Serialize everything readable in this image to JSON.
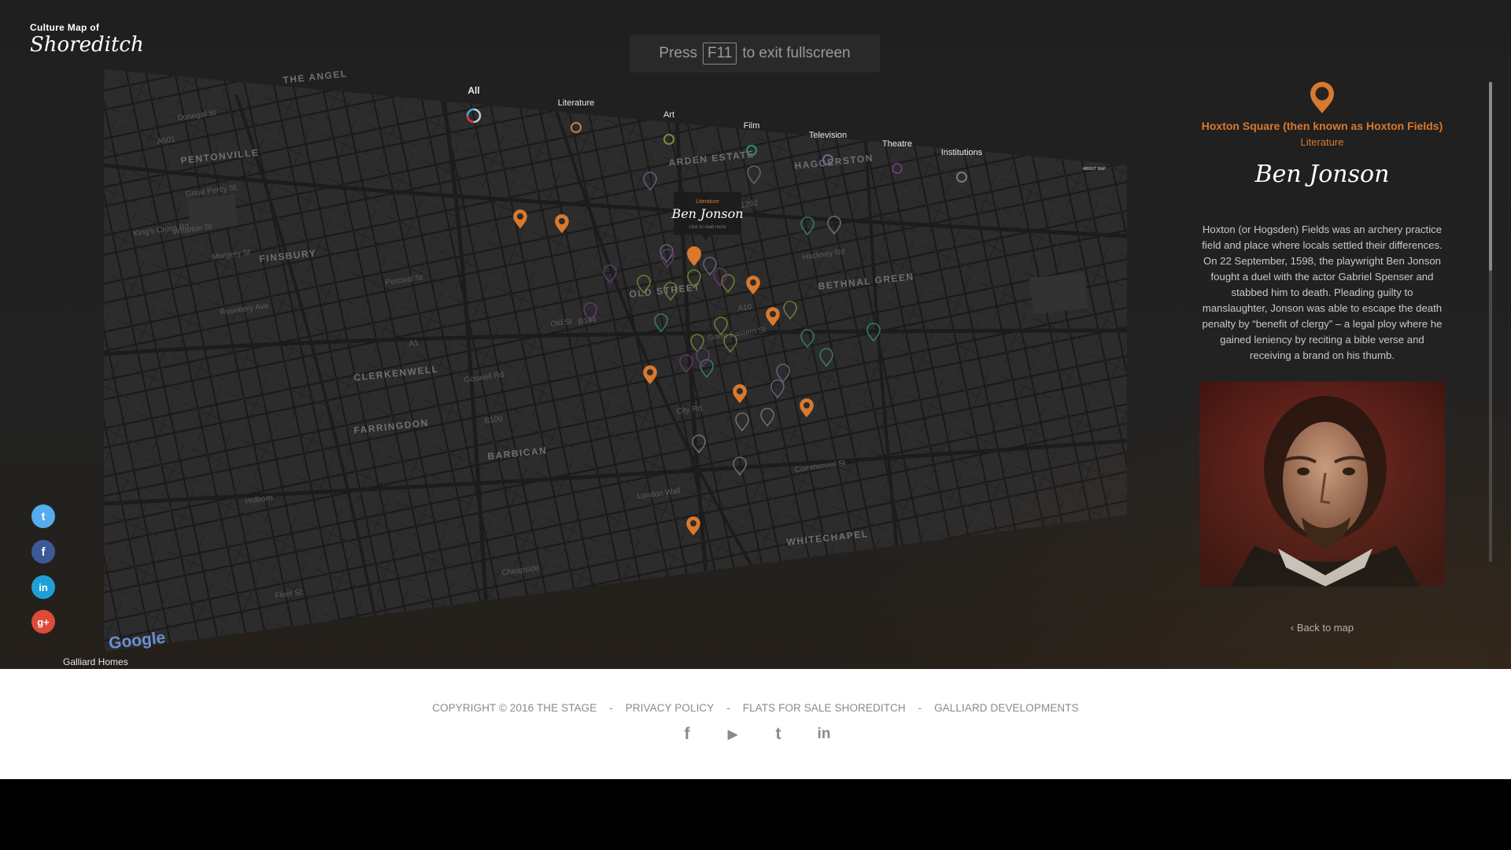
{
  "logo": {
    "line1": "Culture Map of",
    "line2": "Shoreditch"
  },
  "fullscreen_notice": {
    "prefix": "Press",
    "key": "F11",
    "suffix": "to exit fullscreen"
  },
  "map": {
    "categories": [
      {
        "label": "All"
      },
      {
        "label": "Literature"
      },
      {
        "label": "Art"
      },
      {
        "label": "Film"
      },
      {
        "label": "Television"
      },
      {
        "label": "Theatre"
      },
      {
        "label": "Institutions"
      }
    ],
    "areas": [
      "PENTONVILLE",
      "FINSBURY",
      "CLERKENWELL",
      "FARRINGDON",
      "BARBICAN",
      "OLD STREET",
      "HAGGERSTON",
      "ARDEN ESTATE",
      "BETHNAL GREEN",
      "WHITECHAPEL",
      "THE ANGEL"
    ],
    "road_labels": [
      "Donegal St",
      "A501",
      "Great Percy St",
      "King's Cross Rd",
      "Wharton St",
      "Margery St",
      "Rosebery Ave",
      "Percival St",
      "Old St",
      "Goswell Rd",
      "A1",
      "B100",
      "Fleet St",
      "Holborn",
      "Cheapside",
      "London Wall",
      "A10",
      "A1202",
      "B144",
      "City Rd",
      "Hackney Rd",
      "Great Eastern St",
      "Commercial St"
    ],
    "tooltip": {
      "category": "Literature",
      "title": "Ben Jonson",
      "hint": "click to read more"
    },
    "google_logo": "Google",
    "about_label": "ABOUT MAP",
    "colors": {
      "literature": "#d9792e",
      "art": "#7a8a3a",
      "film": "#3a8a6a",
      "television": "#6a6a8a",
      "theatre": "#6a3a7a",
      "institutions": "#7a7a7a"
    }
  },
  "social": [
    {
      "name": "twitter",
      "glyph": "t",
      "color": "#55acee"
    },
    {
      "name": "facebook",
      "glyph": "f",
      "color": "#3b5998"
    },
    {
      "name": "linkedin",
      "glyph": "in",
      "color": "#1e9fd8"
    },
    {
      "name": "google-plus",
      "glyph": "g+",
      "color": "#dd4b39"
    }
  ],
  "galliard_label": "Galliard Homes",
  "detail": {
    "location": "Hoxton Square (then known as Hoxton Fields)",
    "category": "Literature",
    "title": "Ben Jonson",
    "description": "Hoxton (or Hogsden) Fields was an archery practice field and place where locals settled their differences. On 22 September, 1598, the playwright Ben Jonson fought a duel with the actor Gabriel Spenser and stabbed him to death. Pleading guilty to manslaughter, Jonson was able to escape the death penalty by “benefit of clergy” – a legal ploy where he gained leniency by reciting a bible verse and receiving a brand on his thumb.",
    "back_label": "Back to map",
    "accent": "#d9792e"
  },
  "footer": {
    "links": [
      "COPYRIGHT © 2016 THE STAGE",
      "PRIVACY POLICY",
      "FLATS FOR SALE SHOREDITCH",
      "GALLIARD DEVELOPMENTS"
    ],
    "separator": "-",
    "icons": [
      {
        "name": "facebook",
        "glyph": "f"
      },
      {
        "name": "youtube",
        "glyph": "▶"
      },
      {
        "name": "twitter",
        "glyph": "t"
      },
      {
        "name": "linkedin",
        "glyph": "in"
      }
    ]
  }
}
